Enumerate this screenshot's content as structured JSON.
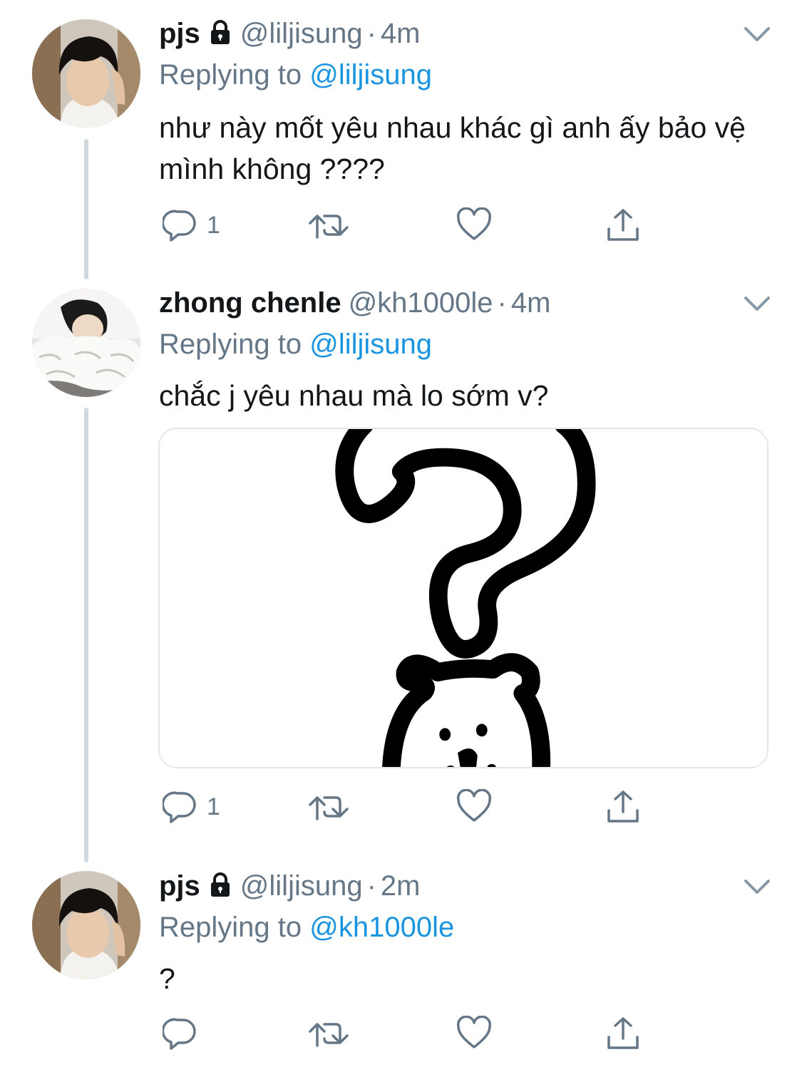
{
  "tweets": [
    {
      "name": "pjs",
      "locked": true,
      "handle": "@liljisung",
      "separator": "·",
      "time": "4m",
      "replying_prefix": "Replying to",
      "replying_to": "@liljisung",
      "text": "như này mốt yêu nhau khác gì anh ấy bảo vệ mình không ????",
      "reply_count": "1",
      "avatar_icon": "avatar-dark-hair-icon"
    },
    {
      "name": "zhong chenle",
      "locked": false,
      "handle": "@kh1000le",
      "separator": "·",
      "time": "4m",
      "replying_prefix": "Replying to",
      "replying_to": "@liljisung",
      "text": "chắc j yêu nhau mà lo sớm v?",
      "reply_count": "1",
      "media": "question-mark-bear-drawing",
      "avatar_icon": "avatar-fluffy-pillow-icon"
    },
    {
      "name": "pjs",
      "locked": true,
      "handle": "@liljisung",
      "separator": "·",
      "time": "2m",
      "replying_prefix": "Replying to",
      "replying_to": "@kh1000le",
      "text": "?",
      "reply_count": "",
      "avatar_icon": "avatar-dark-hair-icon"
    }
  ],
  "colors": {
    "text": "#14171a",
    "secondary": "#657786",
    "mention": "#1b95e0",
    "thread_line": "#cfd9de",
    "media_border": "#e1e8ed"
  },
  "icons": {
    "reply": "reply-icon",
    "retweet": "retweet-icon",
    "like": "heart-icon",
    "share": "share-icon",
    "menu": "chevron-down-icon",
    "lock": "lock-icon"
  }
}
